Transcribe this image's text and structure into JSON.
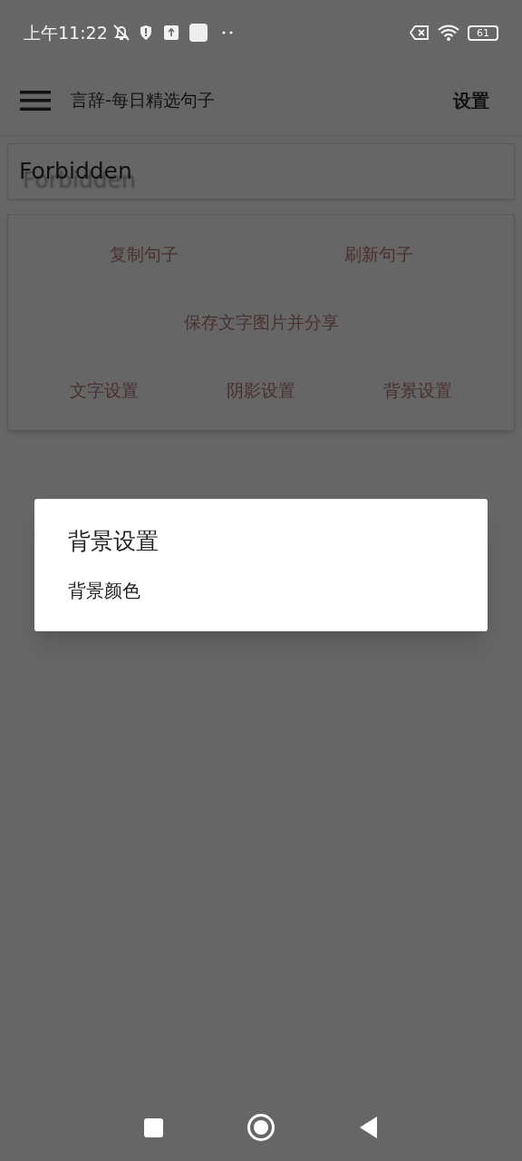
{
  "status_bar": {
    "time": "上午11:22",
    "battery": "61"
  },
  "app_bar": {
    "title": "言辞-每日精选句子",
    "action": "设置"
  },
  "sentence": {
    "text": "Forbidden"
  },
  "actions": [
    [
      "复制句子",
      "刷新句子"
    ],
    [
      "保存文字图片并分享"
    ],
    [
      "文字设置",
      "阴影设置",
      "背景设置"
    ]
  ],
  "dialog": {
    "title": "背景设置",
    "items": [
      "背景颜色"
    ]
  }
}
